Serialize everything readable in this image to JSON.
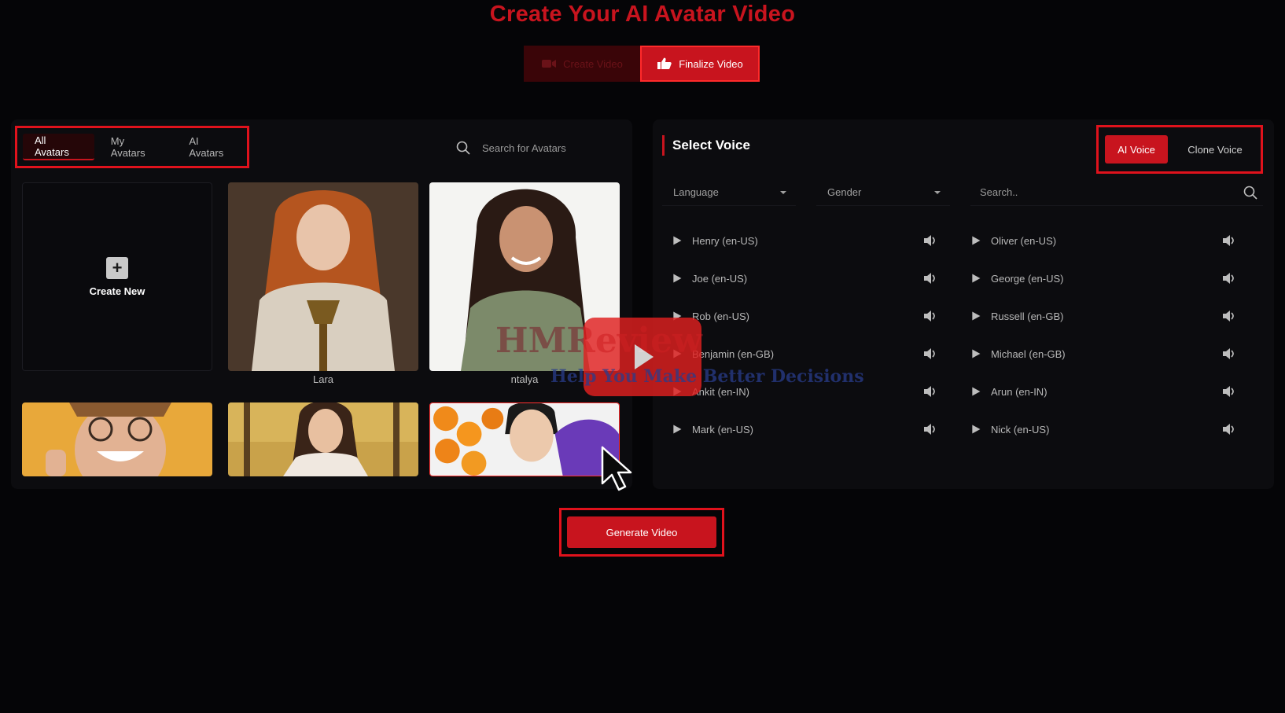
{
  "page": {
    "title": "Create Your AI Avatar Video"
  },
  "steps": [
    {
      "label": "Create Video",
      "icon": "video-camera-icon",
      "active": false
    },
    {
      "label": "Finalize Video",
      "icon": "thumbs-up-icon",
      "active": true
    }
  ],
  "avatars": {
    "tabs": [
      {
        "label": "All Avatars",
        "selected": true
      },
      {
        "label": "My Avatars",
        "selected": false
      },
      {
        "label": "AI Avatars",
        "selected": false
      }
    ],
    "search_placeholder": "Search for Avatars",
    "create_label": "Create New",
    "items": [
      {
        "name": "Lara"
      },
      {
        "name": "ntalya"
      },
      {
        "name": ""
      },
      {
        "name": ""
      },
      {
        "name": ""
      }
    ]
  },
  "voice": {
    "title": "Select Voice",
    "toggle": [
      {
        "label": "AI Voice",
        "selected": true
      },
      {
        "label": "Clone Voice",
        "selected": false
      }
    ],
    "language_label": "Language",
    "gender_label": "Gender",
    "search_placeholder": "Search..",
    "list": [
      "Henry (en-US)",
      "Oliver (en-US)",
      "Joe (en-US)",
      "George (en-US)",
      "Rob (en-US)",
      "Russell (en-GB)",
      "Benjamin (en-GB)",
      "Michael (en-GB)",
      "Ankit (en-IN)",
      "Arun (en-IN)",
      "Mark (en-US)",
      "Nick (en-US)"
    ]
  },
  "generate": {
    "label": "Generate Video"
  },
  "watermark": {
    "brand": "HMReview",
    "tagline": "Help You Make Better Decisions"
  },
  "colors": {
    "accent": "#c8141e",
    "highlight": "#e0121c",
    "background": "#050507",
    "panel": "#0c0c0f"
  }
}
